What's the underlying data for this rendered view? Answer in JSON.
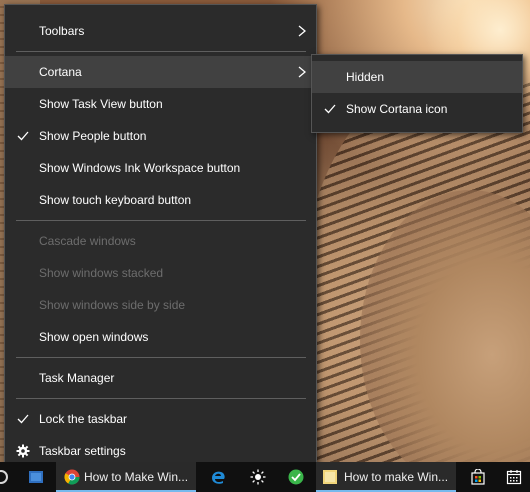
{
  "context_menu": {
    "items": [
      {
        "label": "Toolbars",
        "has_submenu": true
      },
      {
        "label": "Cortana",
        "has_submenu": true,
        "highlighted": true
      },
      {
        "label": "Show Task View button"
      },
      {
        "label": "Show People button",
        "checked": true
      },
      {
        "label": "Show Windows Ink Workspace button"
      },
      {
        "label": "Show touch keyboard button"
      },
      {
        "label": "Cascade windows",
        "disabled": true
      },
      {
        "label": "Show windows stacked",
        "disabled": true
      },
      {
        "label": "Show windows side by side",
        "disabled": true
      },
      {
        "label": "Show open windows"
      },
      {
        "label": "Task Manager"
      },
      {
        "label": "Lock the taskbar",
        "checked": true
      },
      {
        "label": "Taskbar settings",
        "icon": "gear-icon"
      }
    ]
  },
  "cortana_submenu": {
    "items": [
      {
        "label": "Hidden",
        "highlighted": true
      },
      {
        "label": "Show Cortana icon",
        "checked": true
      }
    ]
  },
  "taskbar": {
    "app1_label": "How to Make Win...",
    "app2_label": "How to make Win...",
    "icons": [
      "cortana-ring-icon",
      "people-icon",
      "chrome-icon",
      "edge-icon",
      "brightness-icon",
      "green-app-icon",
      "folder-icon",
      "store-icon",
      "calendar-icon"
    ]
  },
  "colors": {
    "menu_bg": "#2b2b2b",
    "menu_hover": "#414141",
    "separator": "#5f5f5f",
    "disabled_text": "#6d6d6d",
    "taskbar_bg": "#101010",
    "active_app_underline": "#76b9ed"
  }
}
